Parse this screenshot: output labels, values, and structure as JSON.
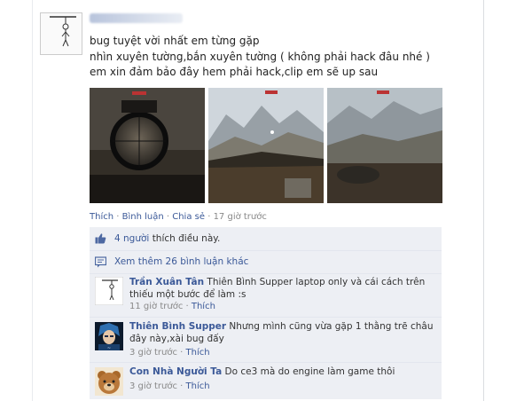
{
  "post": {
    "lines": [
      "bug tuyệt vời nhất em từng gặp",
      "nhìn xuyên tường,bắn xuyên tường ( không phải hack đâu nhé )",
      "em xin đảm bảo đây hem phải hack,clip em sẽ up sau"
    ],
    "actions": {
      "like": "Thích",
      "comment": "Bình luận",
      "share": "Chia sẻ",
      "time": "17 giờ trước"
    }
  },
  "feedback": {
    "likes_count_text": "4 người",
    "likes_suffix": "thích điều này.",
    "view_more": "Xem thêm 26 bình luận khác"
  },
  "comments": [
    {
      "author": "Trần Xuân Tân",
      "text": "Thiên Bình Supper laptop only và cái cách trên thiếu một bước để làm :s",
      "time": "11 giờ trước",
      "like": "Thích"
    },
    {
      "author": "Thiên Bình Supper",
      "text": "Nhưng mình cũng vừa gặp 1 thằng trẽ châu đây này,xài bug đấy",
      "time": "3 giờ trước",
      "like": "Thích"
    },
    {
      "author": "Con Nhà Người Ta",
      "text": "Do ce3 mà do engine làm game thôi",
      "time": "3 giờ trước",
      "like": "Thích"
    }
  ],
  "colors": {
    "link": "#3b5998",
    "feedback_bg": "#edeff4",
    "muted": "#888888"
  }
}
